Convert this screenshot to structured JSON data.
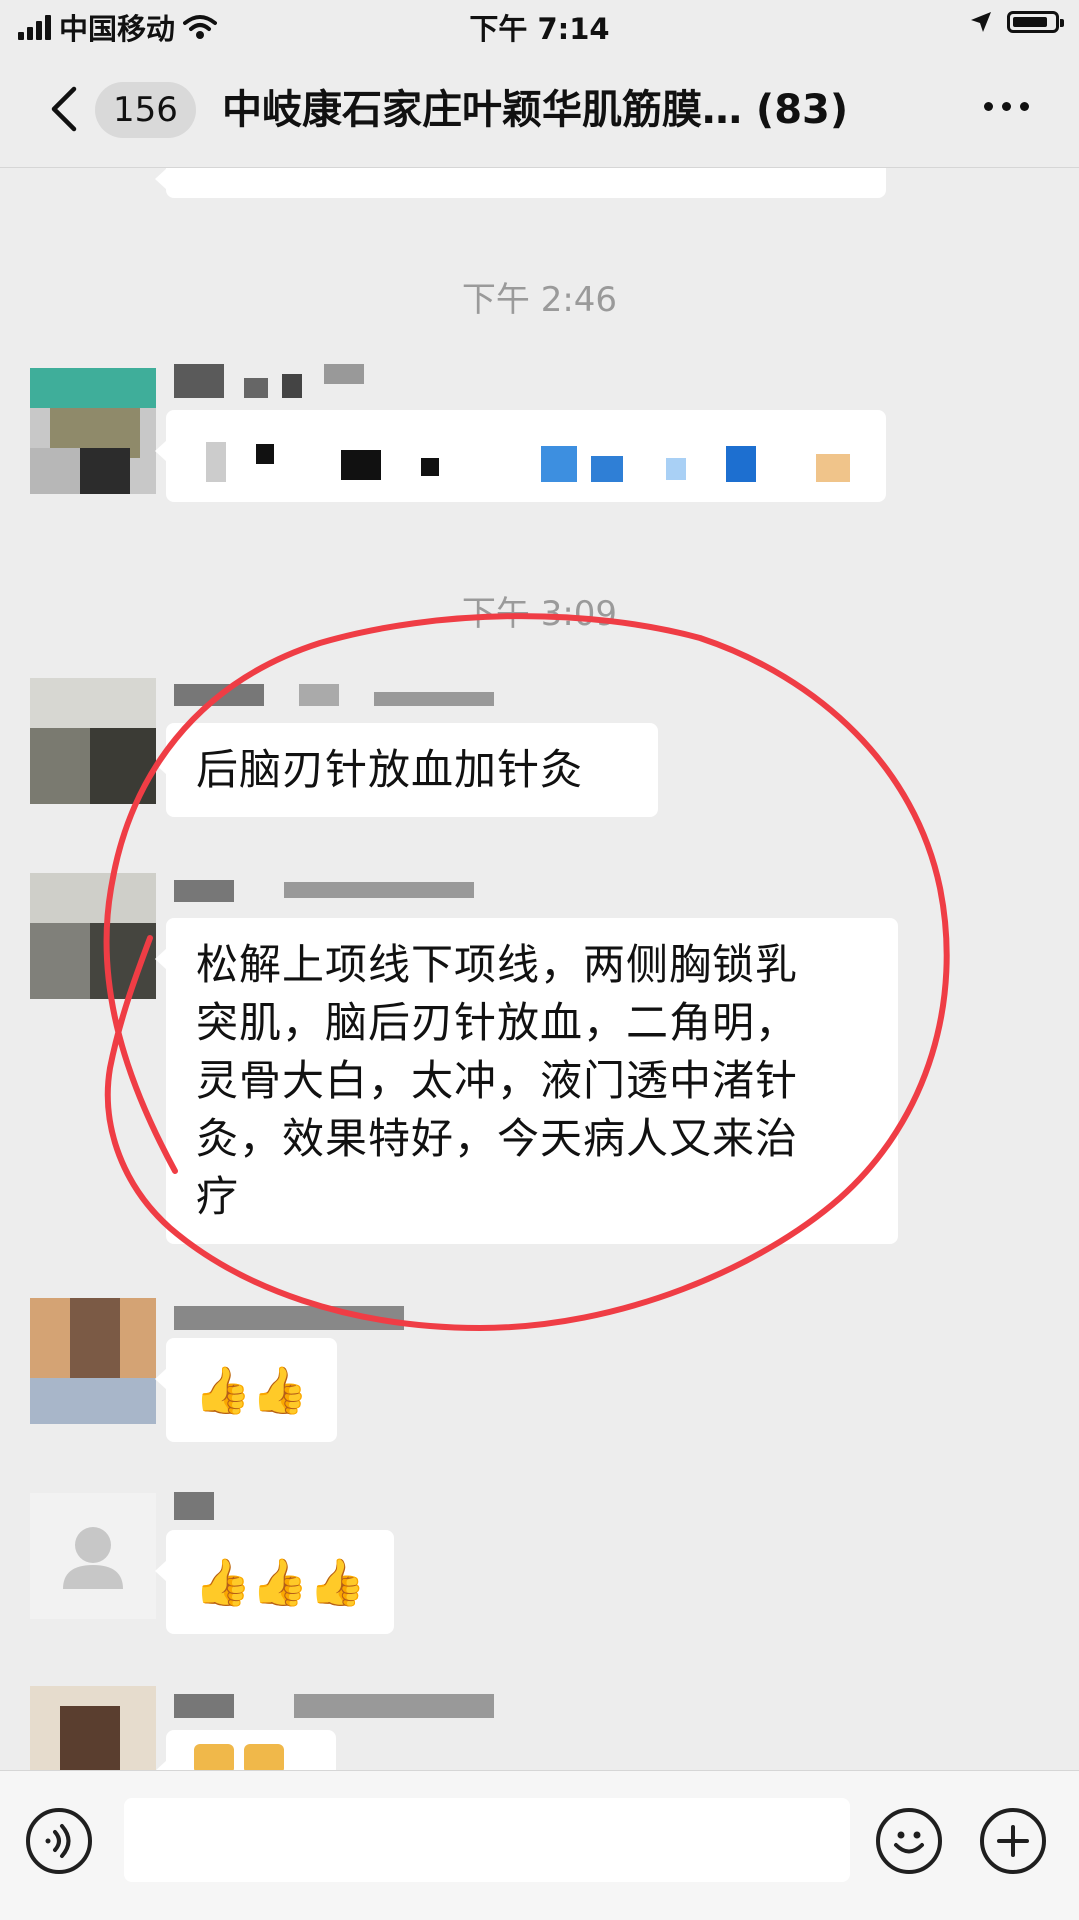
{
  "status_bar": {
    "carrier": "中国移动",
    "time": "下午 7:14"
  },
  "header": {
    "unread_count": "156",
    "title": "中岐康石家庄叶颖华肌筋膜… (83)"
  },
  "messages": [
    {
      "type": "timestamp",
      "text": "下午 2:46"
    },
    {
      "type": "timestamp",
      "text": "下午 3:09"
    },
    {
      "type": "text",
      "text": "后脑刃针放血加针灸"
    },
    {
      "type": "text",
      "text": "松解上项线下项线，两侧胸锁乳\n突肌，脑后刃针放血，二角明，\n灵骨大白，太冲，液门透中渚针\n灸，效果特好，今天病人又来治\n疗"
    },
    {
      "type": "emoji",
      "text": "👍👍"
    },
    {
      "type": "emoji",
      "text": "👍👍👍"
    }
  ],
  "icons": {
    "back": "chevron-left-icon",
    "more": "more-dots-icon",
    "voice": "voice-icon",
    "emoji": "smiley-icon",
    "plus": "plus-icon",
    "location": "location-arrow-icon",
    "wifi": "wifi-icon",
    "battery": "battery-icon",
    "default_avatar": "person-icon"
  },
  "colors": {
    "background": "#ededed",
    "bubble": "#ffffff",
    "annotation_circle": "#ef3d45"
  },
  "input": {
    "placeholder": ""
  }
}
